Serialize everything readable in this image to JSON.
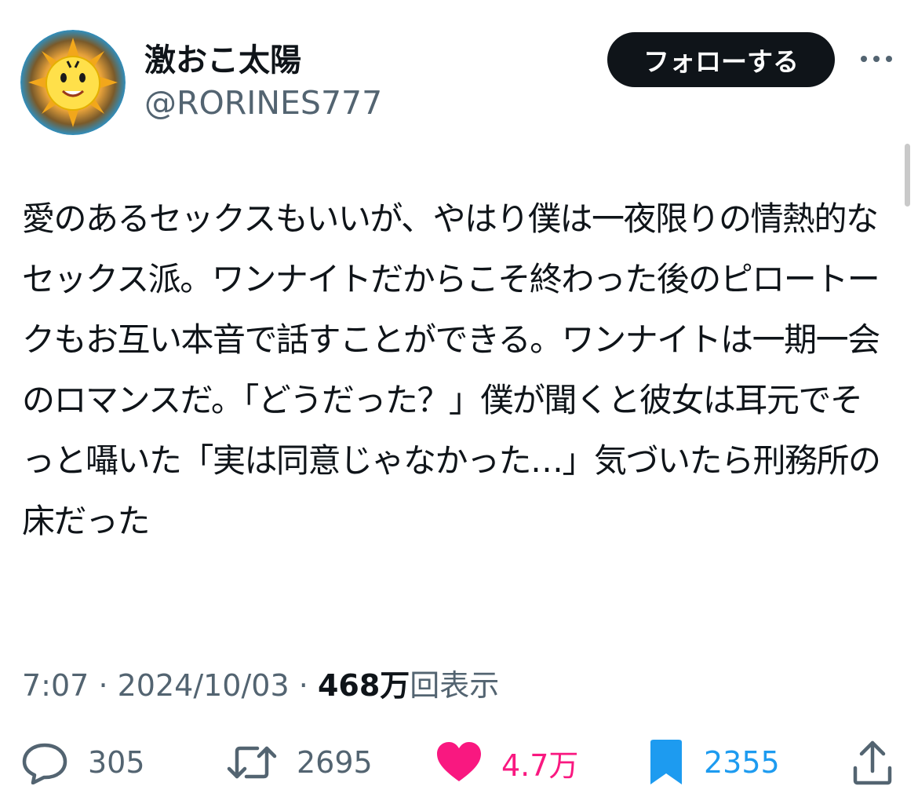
{
  "user": {
    "display_name": "激おこ太陽",
    "handle": "@RORINES777",
    "avatar_icon": "angry-sun-avatar-icon"
  },
  "follow_label": "フォローする",
  "more_icon": "more-dots-icon",
  "tweet": {
    "text": "愛のあるセックスもいいが、やはり僕は一夜限りの情熱的なセックス派。ワンナイトだからこそ終わった後のピロートークもお互い本音で話すことができる。ワンナイトは一期一会のロマンスだ。「どうだった？」僕が聞くと彼女は耳元でそっと囁いた「実は同意じゃなかった…」気づいたら刑務所の床だった"
  },
  "meta": {
    "time": "7:07",
    "sep1": "·",
    "date": "2024/10/03",
    "sep2": "·",
    "views_count": "468万",
    "views_label": "回表示"
  },
  "actions": {
    "reply": {
      "icon": "reply-bubble-icon",
      "count": "305"
    },
    "retweet": {
      "icon": "retweet-icon",
      "count": "2695"
    },
    "like": {
      "icon": "heart-icon",
      "count": "4.7万"
    },
    "bookmark": {
      "icon": "bookmark-icon",
      "count": "2355"
    },
    "share": {
      "icon": "share-icon"
    }
  },
  "colors": {
    "text": "#0f1419",
    "secondary": "#536471",
    "like": "#f91880",
    "bookmark": "#1d9bf0",
    "button_bg": "#0f1419"
  }
}
